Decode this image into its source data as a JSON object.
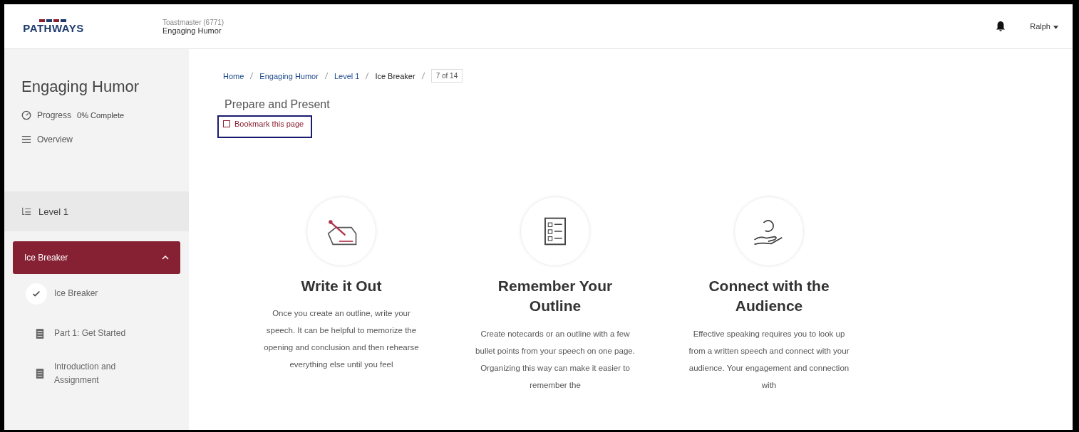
{
  "header": {
    "logo": "PATHWAYS",
    "subtitle": "Toastmaster (6771)",
    "title": "Engaging Humor",
    "user": "Ralph"
  },
  "sidebar": {
    "title": "Engaging Humor",
    "progress_label": "Progress",
    "progress_value": "0% Complete",
    "overview": "Overview",
    "level": {
      "label": "Level 1",
      "children": [
        {
          "label": "Ice Breaker",
          "expanded": true,
          "selected": true,
          "children": [
            {
              "label": "Ice Breaker",
              "kind": "check"
            },
            {
              "label": "Part 1: Get Started",
              "kind": "doc"
            },
            {
              "label": "Introduction and Assignment",
              "kind": "doc"
            }
          ]
        }
      ]
    }
  },
  "breadcrumb": [
    {
      "label": "Home",
      "kind": "link"
    },
    {
      "label": "Engaging Humor",
      "kind": "link"
    },
    {
      "label": "Level 1",
      "kind": "link"
    },
    {
      "label": "Ice Breaker",
      "kind": "current"
    },
    {
      "label": "7 of 14",
      "kind": "count"
    }
  ],
  "page_title": "Prepare and Present",
  "bookmark": {
    "label": "Bookmark this page",
    "checked": false
  },
  "cards": [
    {
      "kind": "write",
      "title": "Write it Out",
      "text": "Once you create an outline, write your speech. It can be helpful to memorize the opening and conclusion and then rehearse everything else until you feel"
    },
    {
      "kind": "list",
      "title": "Remember Your Outline",
      "text": "Create notecards or an outline with a few bullet points from your speech on one page. Organizing this way can make it easier to remember the"
    },
    {
      "kind": "connect",
      "title": "Connect with the Audience",
      "text": "Effective speaking requires you to look up from a written speech and connect with your audience. Your engagement and connection with"
    }
  ]
}
